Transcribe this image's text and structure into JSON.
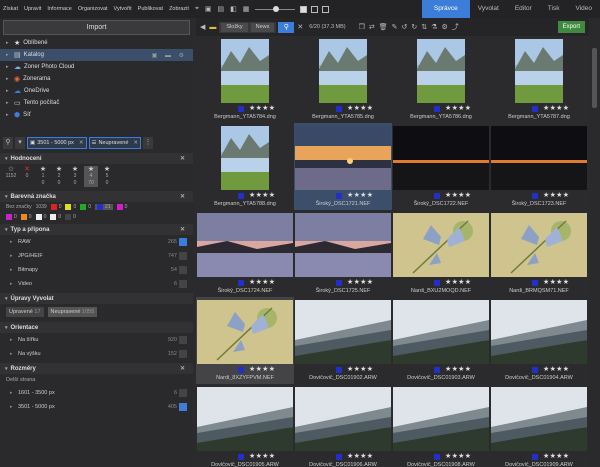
{
  "menu": [
    "Získat",
    "Upravit",
    "Informace",
    "Organizovat",
    "Vytvořit",
    "Publikovat",
    "Zobrazit"
  ],
  "modes": [
    "Správce",
    "Vyvolat",
    "Editor",
    "Tisk",
    "Video"
  ],
  "left": {
    "import_label": "Import",
    "folders": [
      {
        "label": "Oblíbené",
        "icon": "★",
        "color": "#ddd"
      },
      {
        "label": "Katalog",
        "icon": "▤",
        "color": "#ccc"
      },
      {
        "label": "Zoner Photo Cloud",
        "icon": "☁",
        "color": "#7ab0e8"
      },
      {
        "label": "Zonerama",
        "icon": "◉",
        "color": "#e86a3a"
      },
      {
        "label": "OneDrive",
        "icon": "☁",
        "color": "#3b7dd8"
      },
      {
        "label": "Tento počítač",
        "icon": "▭",
        "color": "#ccc"
      },
      {
        "label": "Síť",
        "icon": "⬢",
        "color": "#3b7dd8"
      }
    ],
    "filters": [
      "3501 - 5000 px",
      "Neupravené"
    ],
    "rating_title": "Hodnocení",
    "stars": [
      {
        "label": "☆",
        "count": "1152"
      },
      {
        "label": "✕",
        "count": "0"
      },
      {
        "label": "1",
        "count": "0"
      },
      {
        "label": "2",
        "count": "0"
      },
      {
        "label": "3",
        "count": "0"
      },
      {
        "label": "4",
        "count": "70"
      },
      {
        "label": "5",
        "count": "0"
      }
    ],
    "color_title": "Barevná značka",
    "no_label": "Bez značky",
    "no_label_count": "1039",
    "colors_row1": [
      {
        "color": "#d22",
        "count": "0"
      },
      {
        "color": "#dd2",
        "count": "0"
      },
      {
        "color": "#2a2",
        "count": "0"
      },
      {
        "color": "#2230c8",
        "count": "21"
      },
      {
        "color": "#c2c",
        "count": "0"
      }
    ],
    "colors_row2": [
      {
        "color": "#c2c",
        "count": "0"
      },
      {
        "color": "#e82",
        "count": "0"
      },
      {
        "color": "#eee",
        "count": "0"
      },
      {
        "color": "#eee",
        "count": "0"
      },
      {
        "color": "#444",
        "count": "0"
      }
    ],
    "type_title": "Typ a přípona",
    "types": [
      {
        "label": "RAW",
        "count": "265",
        "on": true
      },
      {
        "label": "JPG/HEIF",
        "count": "747",
        "on": false
      },
      {
        "label": "Bitmapy",
        "count": "54",
        "on": false
      },
      {
        "label": "Video",
        "count": "6",
        "on": false
      }
    ],
    "edits_title": "Úpravy Vyvolat",
    "edits": [
      {
        "label": "Upravené",
        "count": "17"
      },
      {
        "label": "Neupravené",
        "count": "1055"
      }
    ],
    "orient_title": "Orientace",
    "orients": [
      {
        "label": "Na šířku",
        "count": "920"
      },
      {
        "label": "Na výšku",
        "count": "152"
      }
    ],
    "dims_title": "Rozměry",
    "dims_sub": "Delší strana",
    "dims": [
      {
        "label": "1601 - 3500 px",
        "count": "6",
        "on": false
      },
      {
        "label": "3501 - 5000 px",
        "count": "405",
        "on": true
      }
    ]
  },
  "toolbar": {
    "crumbs": [
      "Složky",
      "News"
    ],
    "count": "6/20 (37.3 MB)",
    "export": "Export"
  },
  "thumbs": [
    {
      "name": "Bergmann_YTA5784.dng",
      "kind": "mountain",
      "port": true,
      "st": "★★★★"
    },
    {
      "name": "Bergmann_YTA5785.dng",
      "kind": "mountain",
      "port": true,
      "st": "★★★★"
    },
    {
      "name": "Bergmann_YTA5786.dng",
      "kind": "mountain",
      "port": true,
      "st": "★★★★"
    },
    {
      "name": "Bergmann_YTA5787.dng",
      "kind": "mountain",
      "port": true,
      "st": "★★★★"
    },
    {
      "name": "Bergmann_YTA5788.dng",
      "kind": "mountain",
      "port": true,
      "st": "★★★★"
    },
    {
      "name": "Široký_DSC1721.NEF",
      "kind": "sunset",
      "port": false,
      "st": "★★★★"
    },
    {
      "name": "Široký_DSC1722.NEF",
      "kind": "dark",
      "port": false,
      "st": "★★★★"
    },
    {
      "name": "Široký_DSC1723.NEF",
      "kind": "dark",
      "port": false,
      "st": "★★★★"
    },
    {
      "name": "Široký_DSC1724.NEF",
      "kind": "dusk",
      "port": false,
      "st": "★★★★"
    },
    {
      "name": "Široký_DSC1725.NEF",
      "kind": "dusk",
      "port": false,
      "st": "★★★★"
    },
    {
      "name": "Nardi_BXU2MOQD.NEF",
      "kind": "butterfly",
      "port": false,
      "st": "★★★★"
    },
    {
      "name": "Nardi_BRMQSM71.NEF",
      "kind": "butterfly",
      "port": false,
      "st": "★★★★"
    },
    {
      "name": "Nardi_8XZYFPVM.NEF",
      "kind": "butterfly",
      "port": false,
      "st": "★★★★"
    },
    {
      "name": "Dovičovič_DSC01902.ARW",
      "kind": "coast",
      "port": false,
      "st": "★★★★"
    },
    {
      "name": "Dovičovič_DSC01903.ARW",
      "kind": "coast",
      "port": false,
      "st": "★★★★"
    },
    {
      "name": "Dovičovič_DSC01904.ARW",
      "kind": "coast",
      "port": false,
      "st": "★★★★"
    },
    {
      "name": "Dovičovič_DSC01905.ARW",
      "kind": "coast",
      "port": false,
      "st": "★★★★"
    },
    {
      "name": "Dovičovič_DSC01906.ARW",
      "kind": "coast",
      "port": false,
      "st": "★★★★"
    },
    {
      "name": "Dovičovič_DSC01908.ARW",
      "kind": "coast",
      "port": false,
      "st": "★★★★"
    },
    {
      "name": "Dovičovič_DSC01909.ARW",
      "kind": "coast",
      "port": false,
      "st": "★★★★"
    }
  ]
}
